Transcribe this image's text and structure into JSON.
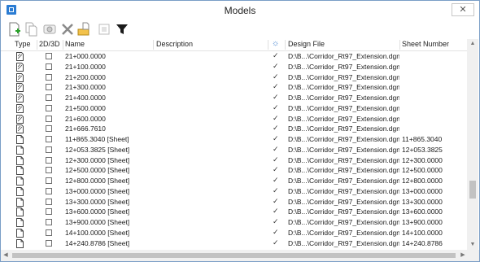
{
  "window": {
    "title": "Models"
  },
  "columns": {
    "type": "Type",
    "dim": "2D/3D",
    "name": "Name",
    "description": "Description",
    "design_file": "Design File",
    "sheet_number": "Sheet Number"
  },
  "toolbar": [
    "new-model-icon",
    "copy-model-icon",
    "properties-icon",
    "delete-icon",
    "import-icon",
    "select-all-icon",
    "filter-icon"
  ],
  "rows": [
    {
      "kind": "design",
      "name": "21+000.0000",
      "design_file": "D:\\B...\\Corridor_Rt97_Extension.dgn",
      "sheet": ""
    },
    {
      "kind": "design",
      "name": "21+100.0000",
      "design_file": "D:\\B...\\Corridor_Rt97_Extension.dgn",
      "sheet": ""
    },
    {
      "kind": "design",
      "name": "21+200.0000",
      "design_file": "D:\\B...\\Corridor_Rt97_Extension.dgn",
      "sheet": ""
    },
    {
      "kind": "design",
      "name": "21+300.0000",
      "design_file": "D:\\B...\\Corridor_Rt97_Extension.dgn",
      "sheet": ""
    },
    {
      "kind": "design",
      "name": "21+400.0000",
      "design_file": "D:\\B...\\Corridor_Rt97_Extension.dgn",
      "sheet": ""
    },
    {
      "kind": "design",
      "name": "21+500.0000",
      "design_file": "D:\\B...\\Corridor_Rt97_Extension.dgn",
      "sheet": ""
    },
    {
      "kind": "design",
      "name": "21+600.0000",
      "design_file": "D:\\B...\\Corridor_Rt97_Extension.dgn",
      "sheet": ""
    },
    {
      "kind": "design",
      "name": "21+666.7610",
      "design_file": "D:\\B...\\Corridor_Rt97_Extension.dgn",
      "sheet": ""
    },
    {
      "kind": "sheet",
      "name": "11+865.3040 [Sheet]",
      "design_file": "D:\\B...\\Corridor_Rt97_Extension.dgn",
      "sheet": "11+865.3040"
    },
    {
      "kind": "sheet",
      "name": "12+053.3825 [Sheet]",
      "design_file": "D:\\B...\\Corridor_Rt97_Extension.dgn",
      "sheet": "12+053.3825"
    },
    {
      "kind": "sheet",
      "name": "12+300.0000 [Sheet]",
      "design_file": "D:\\B...\\Corridor_Rt97_Extension.dgn",
      "sheet": "12+300.0000"
    },
    {
      "kind": "sheet",
      "name": "12+500.0000 [Sheet]",
      "design_file": "D:\\B...\\Corridor_Rt97_Extension.dgn",
      "sheet": "12+500.0000"
    },
    {
      "kind": "sheet",
      "name": "12+800.0000 [Sheet]",
      "design_file": "D:\\B...\\Corridor_Rt97_Extension.dgn",
      "sheet": "12+800.0000"
    },
    {
      "kind": "sheet",
      "name": "13+000.0000 [Sheet]",
      "design_file": "D:\\B...\\Corridor_Rt97_Extension.dgn",
      "sheet": "13+000.0000"
    },
    {
      "kind": "sheet",
      "name": "13+300.0000 [Sheet]",
      "design_file": "D:\\B...\\Corridor_Rt97_Extension.dgn",
      "sheet": "13+300.0000"
    },
    {
      "kind": "sheet",
      "name": "13+600.0000 [Sheet]",
      "design_file": "D:\\B...\\Corridor_Rt97_Extension.dgn",
      "sheet": "13+600.0000"
    },
    {
      "kind": "sheet",
      "name": "13+900.0000 [Sheet]",
      "design_file": "D:\\B...\\Corridor_Rt97_Extension.dgn",
      "sheet": "13+900.0000"
    },
    {
      "kind": "sheet",
      "name": "14+100.0000 [Sheet]",
      "design_file": "D:\\B...\\Corridor_Rt97_Extension.dgn",
      "sheet": "14+100.0000"
    },
    {
      "kind": "sheet",
      "name": "14+240.8786 [Sheet]",
      "design_file": "D:\\B...\\Corridor_Rt97_Extension.dgn",
      "sheet": "14+240.8786"
    }
  ],
  "colors": {
    "accent": "#2b7cd3",
    "filter": "#1a1a1a"
  }
}
